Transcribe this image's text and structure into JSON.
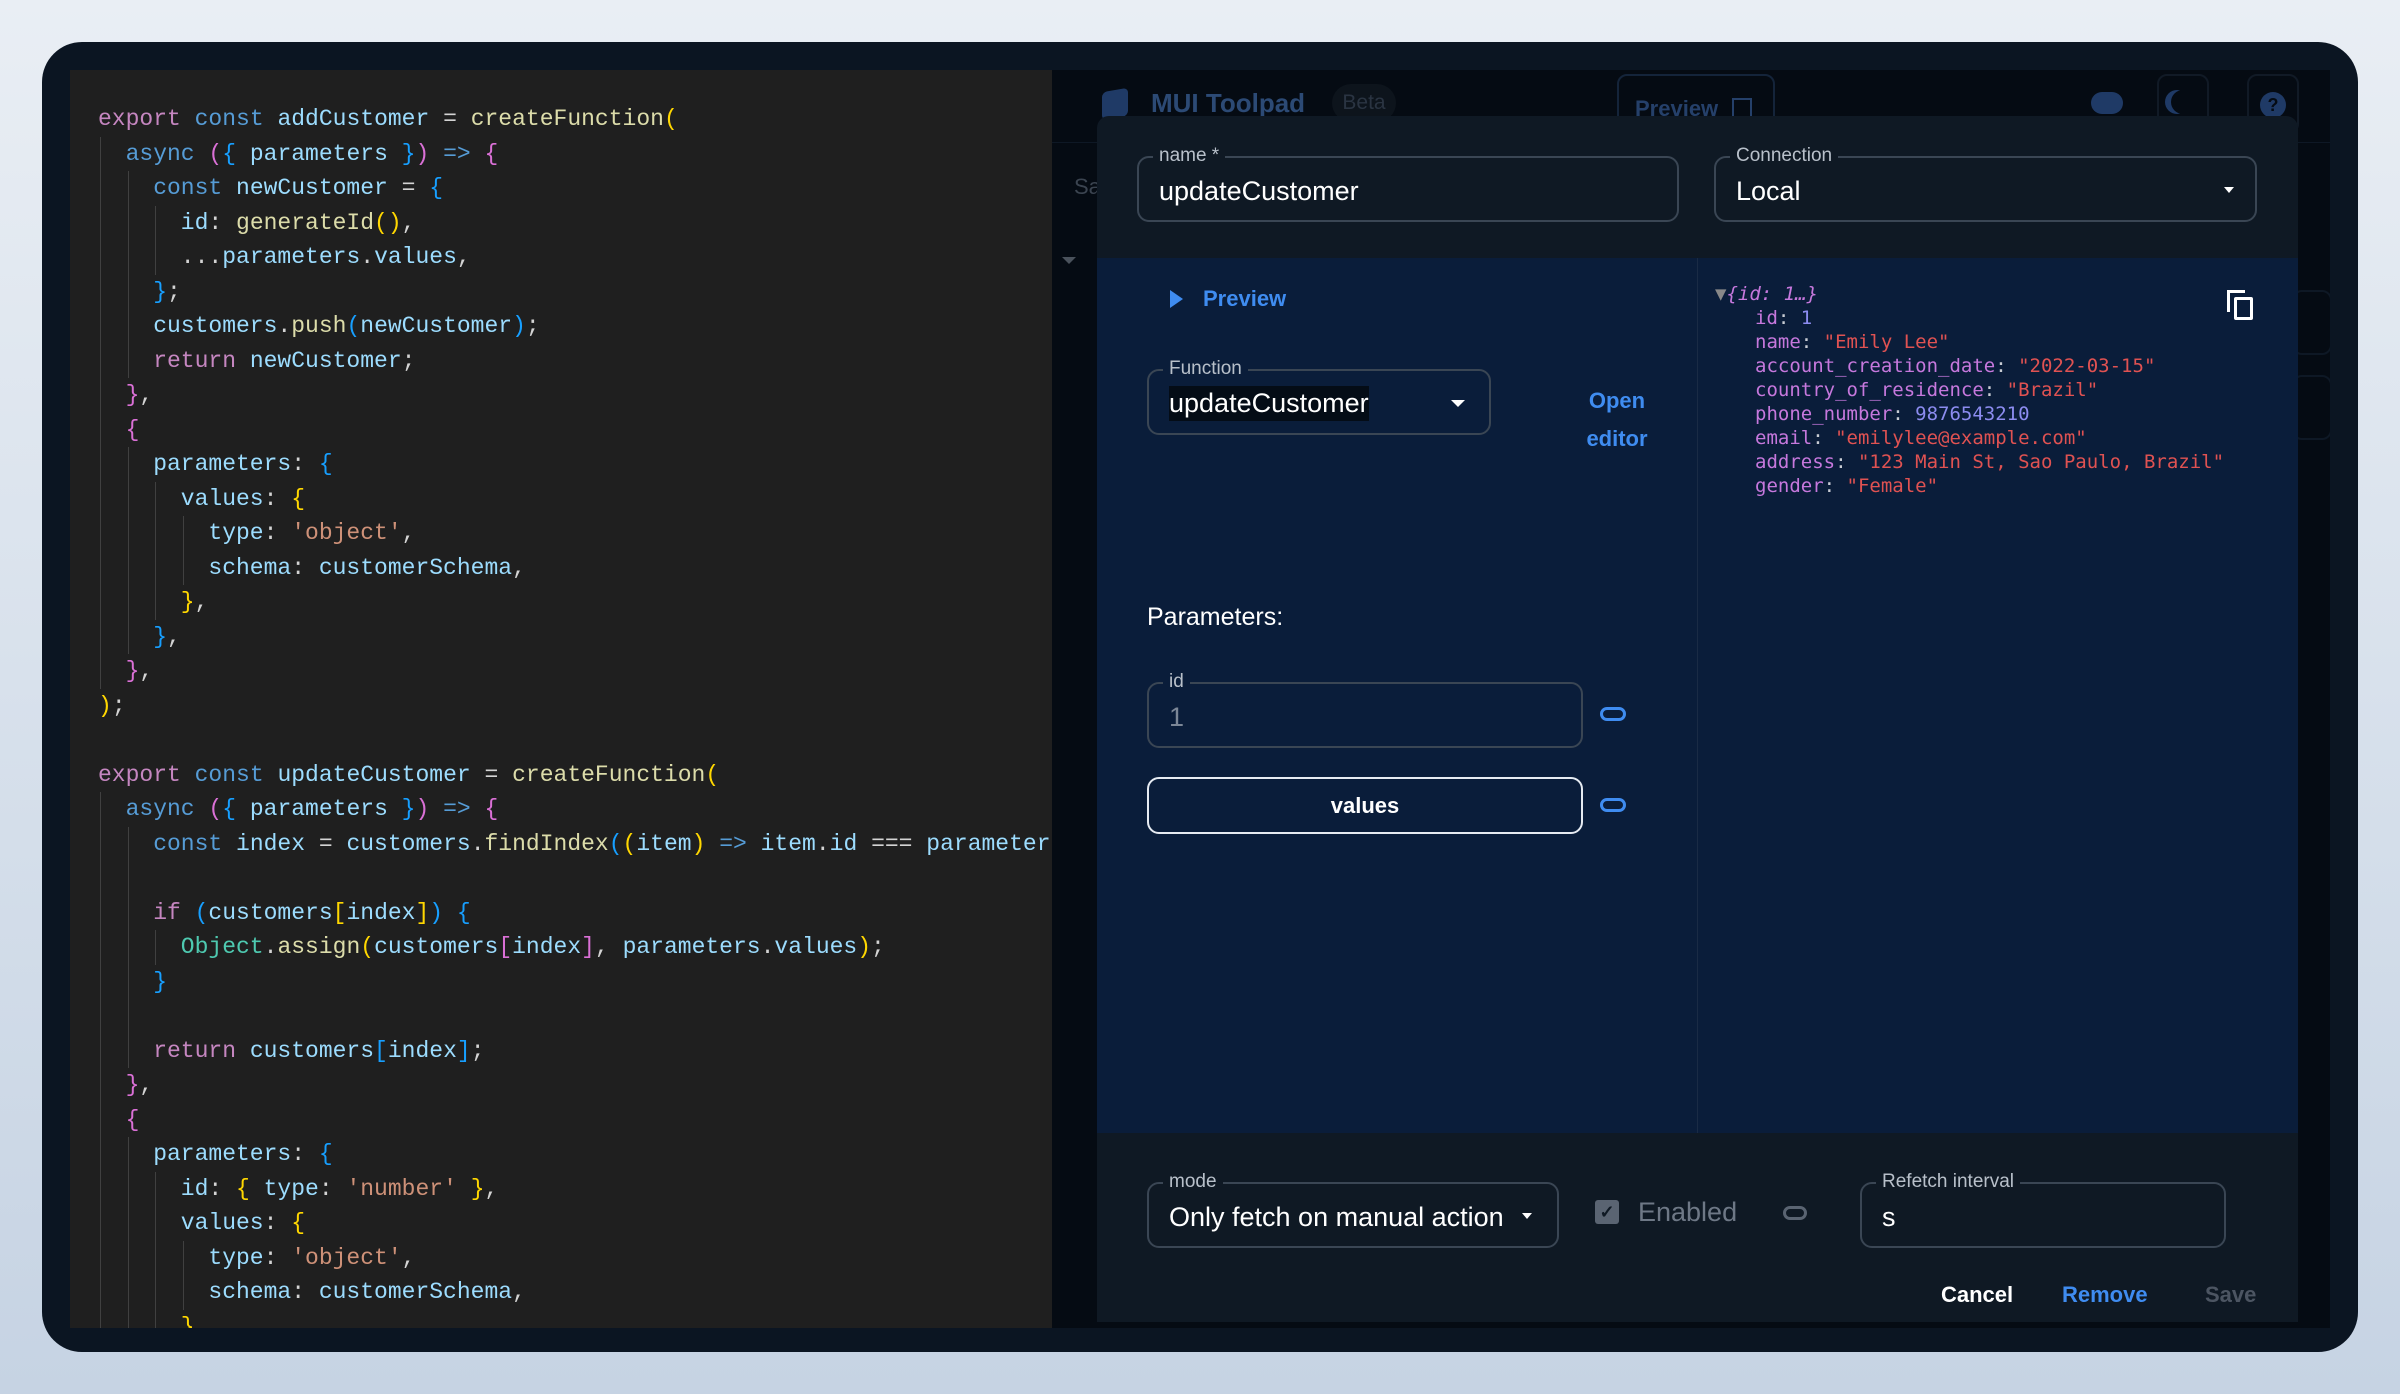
{
  "code_editor": {
    "lines": [
      [
        [
          0
        ],
        [
          "kw",
          "export "
        ],
        [
          "st",
          "const "
        ],
        [
          "vr",
          "addCustomer "
        ],
        [
          "pn",
          "= "
        ],
        [
          "fn",
          "createFunction"
        ],
        [
          "b1",
          "("
        ]
      ],
      [
        [
          1
        ],
        [
          "st",
          "async "
        ],
        [
          "b2",
          "("
        ],
        [
          "b3",
          "{ "
        ],
        [
          "vr",
          "parameters "
        ],
        [
          "b3",
          "}"
        ],
        [
          "b2",
          ") "
        ],
        [
          "st",
          "=> "
        ],
        [
          "b2",
          "{"
        ]
      ],
      [
        [
          2
        ],
        [
          "st",
          "const "
        ],
        [
          "vr",
          "newCustomer "
        ],
        [
          "pn",
          "= "
        ],
        [
          "b3",
          "{"
        ]
      ],
      [
        [
          3
        ],
        [
          "vr",
          "id"
        ],
        [
          "pn",
          ": "
        ],
        [
          "fn",
          "generateId"
        ],
        [
          "b1",
          "()"
        ],
        [
          "pn",
          ","
        ]
      ],
      [
        [
          3
        ],
        [
          "pn",
          "..."
        ],
        [
          "vr",
          "parameters"
        ],
        [
          "pn",
          "."
        ],
        [
          "vr",
          "values"
        ],
        [
          "pn",
          ","
        ]
      ],
      [
        [
          2
        ],
        [
          "b3",
          "}"
        ],
        [
          "pn",
          ";"
        ]
      ],
      [
        [
          2
        ],
        [
          "vr",
          "customers"
        ],
        [
          "pn",
          "."
        ],
        [
          "fn",
          "push"
        ],
        [
          "b3",
          "("
        ],
        [
          "vr",
          "newCustomer"
        ],
        [
          "b3",
          ")"
        ],
        [
          "pn",
          ";"
        ]
      ],
      [
        [
          2
        ],
        [
          "kw",
          "return "
        ],
        [
          "vr",
          "newCustomer"
        ],
        [
          "pn",
          ";"
        ]
      ],
      [
        [
          1
        ],
        [
          "b2",
          "}"
        ],
        [
          "pn",
          ","
        ]
      ],
      [
        [
          1
        ],
        [
          "b2",
          "{"
        ]
      ],
      [
        [
          2
        ],
        [
          "vr",
          "parameters"
        ],
        [
          "pn",
          ": "
        ],
        [
          "b3",
          "{"
        ]
      ],
      [
        [
          3
        ],
        [
          "vr",
          "values"
        ],
        [
          "pn",
          ": "
        ],
        [
          "b1",
          "{"
        ]
      ],
      [
        [
          4
        ],
        [
          "vr",
          "type"
        ],
        [
          "pn",
          ": "
        ],
        [
          "sr",
          "'object'"
        ],
        [
          "pn",
          ","
        ]
      ],
      [
        [
          4
        ],
        [
          "vr",
          "schema"
        ],
        [
          "pn",
          ": "
        ],
        [
          "vr",
          "customerSchema"
        ],
        [
          "pn",
          ","
        ]
      ],
      [
        [
          3
        ],
        [
          "b1",
          "}"
        ],
        [
          "pn",
          ","
        ]
      ],
      [
        [
          2
        ],
        [
          "b3",
          "}"
        ],
        [
          "pn",
          ","
        ]
      ],
      [
        [
          1
        ],
        [
          "b2",
          "}"
        ],
        [
          "pn",
          ","
        ]
      ],
      [
        [
          0
        ],
        [
          "b1",
          ")"
        ],
        [
          "pn",
          ";"
        ]
      ],
      [
        [
          0
        ]
      ],
      [
        [
          0
        ],
        [
          "kw",
          "export "
        ],
        [
          "st",
          "const "
        ],
        [
          "vr",
          "updateCustomer "
        ],
        [
          "pn",
          "= "
        ],
        [
          "fn",
          "createFunction"
        ],
        [
          "b1",
          "("
        ]
      ],
      [
        [
          1
        ],
        [
          "st",
          "async "
        ],
        [
          "b2",
          "("
        ],
        [
          "b3",
          "{ "
        ],
        [
          "vr",
          "parameters "
        ],
        [
          "b3",
          "}"
        ],
        [
          "b2",
          ") "
        ],
        [
          "st",
          "=> "
        ],
        [
          "b2",
          "{"
        ]
      ],
      [
        [
          2
        ],
        [
          "st",
          "const "
        ],
        [
          "vr",
          "index "
        ],
        [
          "pn",
          "= "
        ],
        [
          "vr",
          "customers"
        ],
        [
          "pn",
          "."
        ],
        [
          "fn",
          "findIndex"
        ],
        [
          "b3",
          "("
        ],
        [
          "b1",
          "("
        ],
        [
          "vr",
          "item"
        ],
        [
          "b1",
          ") "
        ],
        [
          "st",
          "=> "
        ],
        [
          "vr",
          "item"
        ],
        [
          "pn",
          "."
        ],
        [
          "vr",
          "id "
        ],
        [
          "pn",
          "=== "
        ],
        [
          "vr",
          "parameter"
        ]
      ],
      [
        [
          2
        ]
      ],
      [
        [
          2
        ],
        [
          "kw",
          "if "
        ],
        [
          "b3",
          "("
        ],
        [
          "vr",
          "customers"
        ],
        [
          "b1",
          "["
        ],
        [
          "vr",
          "index"
        ],
        [
          "b1",
          "]"
        ],
        [
          "b3",
          ") "
        ],
        [
          "b3",
          "{"
        ]
      ],
      [
        [
          3
        ],
        [
          "cs",
          "Object"
        ],
        [
          "pn",
          "."
        ],
        [
          "fn",
          "assign"
        ],
        [
          "b1",
          "("
        ],
        [
          "vr",
          "customers"
        ],
        [
          "b2",
          "["
        ],
        [
          "vr",
          "index"
        ],
        [
          "b2",
          "]"
        ],
        [
          "pn",
          ", "
        ],
        [
          "vr",
          "parameters"
        ],
        [
          "pn",
          "."
        ],
        [
          "vr",
          "values"
        ],
        [
          "b1",
          ")"
        ],
        [
          "pn",
          ";"
        ]
      ],
      [
        [
          2
        ],
        [
          "b3",
          "}"
        ]
      ],
      [
        [
          2
        ]
      ],
      [
        [
          2
        ],
        [
          "kw",
          "return "
        ],
        [
          "vr",
          "customers"
        ],
        [
          "b3",
          "["
        ],
        [
          "vr",
          "index"
        ],
        [
          "b3",
          "]"
        ],
        [
          "pn",
          ";"
        ]
      ],
      [
        [
          1
        ],
        [
          "b2",
          "}"
        ],
        [
          "pn",
          ","
        ]
      ],
      [
        [
          1
        ],
        [
          "b2",
          "{"
        ]
      ],
      [
        [
          2
        ],
        [
          "vr",
          "parameters"
        ],
        [
          "pn",
          ": "
        ],
        [
          "b3",
          "{"
        ]
      ],
      [
        [
          3
        ],
        [
          "vr",
          "id"
        ],
        [
          "pn",
          ": "
        ],
        [
          "b1",
          "{ "
        ],
        [
          "vr",
          "type"
        ],
        [
          "pn",
          ": "
        ],
        [
          "sr",
          "'number' "
        ],
        [
          "b1",
          "}"
        ],
        [
          "pn",
          ","
        ]
      ],
      [
        [
          3
        ],
        [
          "vr",
          "values"
        ],
        [
          "pn",
          ": "
        ],
        [
          "b1",
          "{"
        ]
      ],
      [
        [
          4
        ],
        [
          "vr",
          "type"
        ],
        [
          "pn",
          ": "
        ],
        [
          "sr",
          "'object'"
        ],
        [
          "pn",
          ","
        ]
      ],
      [
        [
          4
        ],
        [
          "vr",
          "schema"
        ],
        [
          "pn",
          ": "
        ],
        [
          "vr",
          "customerSchema"
        ],
        [
          "pn",
          ","
        ]
      ],
      [
        [
          3
        ],
        [
          "b1",
          "}"
        ]
      ]
    ]
  },
  "app": {
    "title": "MUI Toolpad",
    "badge": "Beta",
    "preview_button": "Preview",
    "side_text": "Sa",
    "icons": [
      "cloud-check-icon",
      "dark-mode-icon",
      "help-icon"
    ]
  },
  "dialog": {
    "name_label": "name *",
    "name_value": "updateCustomer",
    "connection_label": "Connection",
    "connection_value": "Local",
    "preview_toggle": "Preview",
    "function_label": "Function",
    "function_value": "updateCustomer",
    "open_editor": [
      "Open",
      "editor"
    ],
    "parameters_heading": "Parameters:",
    "id_label": "id",
    "id_value": "1",
    "values_button": "values",
    "result": {
      "summary": "{id: 1…}",
      "fields": [
        {
          "key": "id",
          "value": "1",
          "type": "number"
        },
        {
          "key": "name",
          "value": "\"Emily Lee\"",
          "type": "string"
        },
        {
          "key": "account_creation_date",
          "value": "\"2022-03-15\"",
          "type": "string"
        },
        {
          "key": "country_of_residence",
          "value": "\"Brazil\"",
          "type": "string"
        },
        {
          "key": "phone_number",
          "value": "9876543210",
          "type": "number"
        },
        {
          "key": "email",
          "value": "\"emilylee@example.com\"",
          "type": "string"
        },
        {
          "key": "address",
          "value": "\"123 Main St, Sao Paulo, Brazil\"",
          "type": "string"
        },
        {
          "key": "gender",
          "value": "\"Female\"",
          "type": "string"
        }
      ]
    },
    "mode_label": "mode",
    "mode_value": "Only fetch on manual action",
    "enabled_label": "Enabled",
    "enabled_checked": true,
    "refetch_label": "Refetch interval",
    "refetch_value": "s",
    "cancel": "Cancel",
    "remove": "Remove",
    "save": "Save"
  },
  "colors": {
    "accent": "#3f8cf0",
    "navy": "#0a1d3a",
    "editor_bg": "#1f1f1f"
  }
}
